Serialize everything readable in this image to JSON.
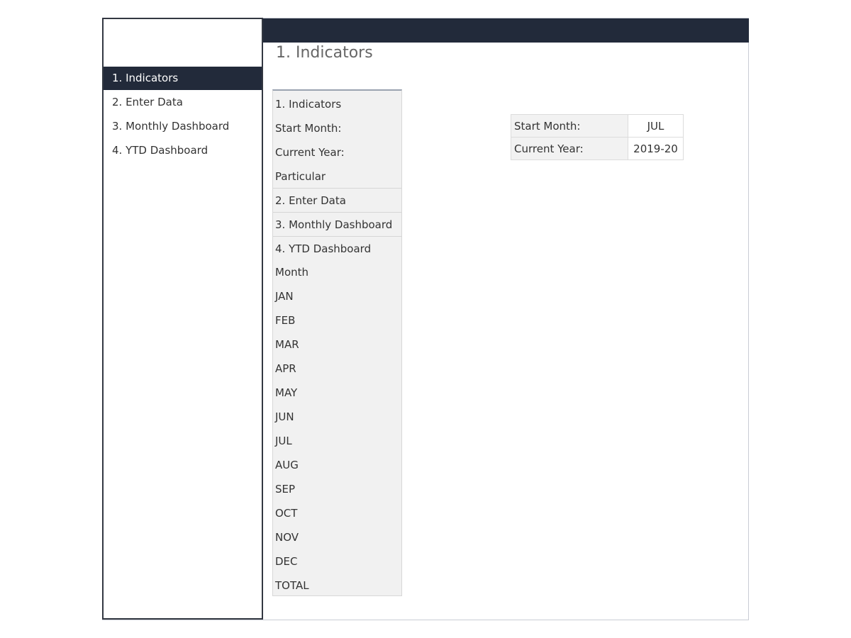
{
  "sidebar": {
    "items": [
      {
        "label": "1. Indicators",
        "active": true
      },
      {
        "label": "2. Enter Data",
        "active": false
      },
      {
        "label": "3. Monthly Dashboard",
        "active": false
      },
      {
        "label": "4. YTD Dashboard",
        "active": false
      }
    ]
  },
  "header": {
    "title": "1. Indicators"
  },
  "list_panel": {
    "rows": [
      "1. Indicators",
      "Start Month:",
      "Current Year:",
      "Particular",
      "2. Enter Data",
      "3. Monthly Dashboard",
      "4. YTD Dashboard",
      "Month",
      "JAN",
      "FEB",
      "MAR",
      "APR",
      "MAY",
      "JUN",
      "JUL",
      "AUG",
      "SEP",
      "OCT",
      "NOV",
      "DEC",
      "TOTAL"
    ]
  },
  "settings": {
    "start_month_label": "Start Month:",
    "start_month_value": "JUL",
    "current_year_label": "Current Year:",
    "current_year_value": "2019-20"
  },
  "colors": {
    "nav_dark": "#222a3a",
    "panel_bg": "#f1f1f1"
  }
}
